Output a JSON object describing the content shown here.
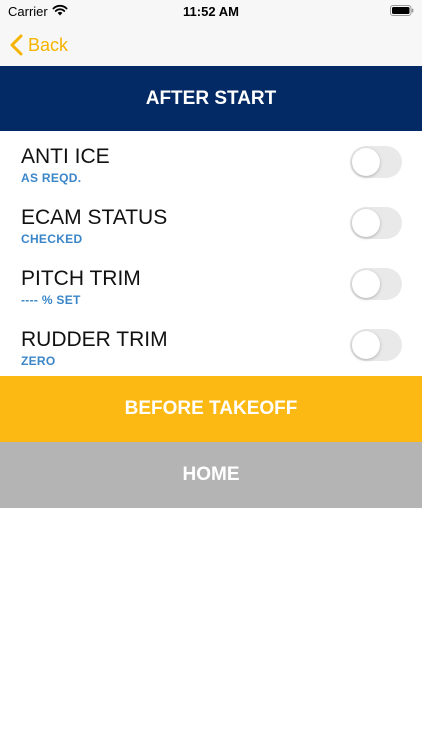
{
  "status_bar": {
    "carrier": "Carrier",
    "time": "11:52 AM"
  },
  "nav": {
    "back_label": "Back",
    "back_icon": "chevron-left-icon",
    "accent_color": "#f5b400"
  },
  "header": {
    "title": "AFTER START",
    "color": "#042a66"
  },
  "checklist": {
    "items": [
      {
        "label": "ANTI ICE",
        "value": "AS REQD.",
        "checked": false
      },
      {
        "label": "ECAM STATUS",
        "value": "CHECKED",
        "checked": false
      },
      {
        "label": "PITCH TRIM",
        "value": "---- % SET",
        "checked": false
      },
      {
        "label": "RUDDER TRIM",
        "value": "ZERO",
        "checked": false
      }
    ]
  },
  "buttons": {
    "next_label": "BEFORE TAKEOFF",
    "next_color": "#fdb913",
    "home_label": "HOME",
    "home_color": "#b4b4b4"
  }
}
